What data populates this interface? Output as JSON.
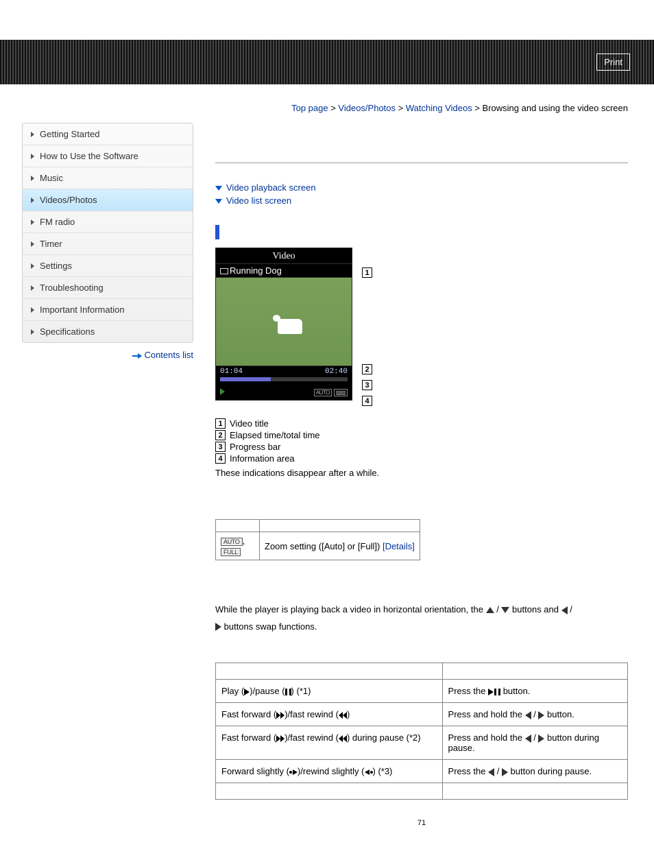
{
  "header": {
    "print": "Print"
  },
  "breadcrumb": {
    "items": [
      "Top page",
      "Videos/Photos",
      "Watching Videos",
      "Browsing and using the video screen"
    ],
    "sep": " > "
  },
  "sidebar": {
    "items": [
      {
        "label": "Getting Started",
        "active": false
      },
      {
        "label": "How to Use the Software",
        "active": false
      },
      {
        "label": "Music",
        "active": false
      },
      {
        "label": "Videos/Photos",
        "active": true
      },
      {
        "label": "FM radio",
        "active": false
      },
      {
        "label": "Timer",
        "active": false
      },
      {
        "label": "Settings",
        "active": false
      },
      {
        "label": "Troubleshooting",
        "active": false
      },
      {
        "label": "Important Information",
        "active": false
      },
      {
        "label": "Specifications",
        "active": false
      }
    ],
    "contents_link": "Contents list"
  },
  "anchors": {
    "a1": "Video playback screen",
    "a2": "Video list screen"
  },
  "screenshot": {
    "title": "Video",
    "filename": "Running Dog",
    "elapsed": "01:04",
    "total": "02:40"
  },
  "callouts": [
    "1",
    "2",
    "3",
    "4"
  ],
  "legend": {
    "l1": "Video title",
    "l2": "Elapsed time/total time",
    "l3": "Progress bar",
    "l4": "Information area"
  },
  "note": "These indications disappear after a while.",
  "zoom_table": {
    "badge1": "AUTO",
    "badge2": "FULL",
    "text": "Zoom setting ([Auto] or [Full]) ",
    "details": "[Details]"
  },
  "hint": {
    "p1a": "While the player is playing back a video in horizontal orientation, the ",
    "p1b": " / ",
    "p1c": " buttons and ",
    "p1d": " / ",
    "p2a": " buttons swap functions."
  },
  "ops_table": {
    "rows": [
      {
        "c1_pre": "Play (",
        "c1_mid": ")/pause (",
        "c1_post": ") (*1)",
        "c2_pre": "Press the ",
        "c2_post": " button."
      },
      {
        "c1_pre": "Fast forward (",
        "c1_mid": ")/fast rewind (",
        "c1_post": ")",
        "c2_pre": "Press and hold the ",
        "c2_mid": " / ",
        "c2_post": " button."
      },
      {
        "c1_pre": "Fast forward (",
        "c1_mid": ")/fast rewind (",
        "c1_post": ") during pause (*2)",
        "c2_pre": "Press and hold the ",
        "c2_mid": " / ",
        "c2_post": " button during pause."
      },
      {
        "c1_pre": "Forward slightly (",
        "c1_mid": ")/rewind slightly (",
        "c1_post": ") (*3)",
        "c2_pre": "Press the ",
        "c2_mid": " / ",
        "c2_post": " button during pause."
      }
    ]
  },
  "pagenum": "71"
}
